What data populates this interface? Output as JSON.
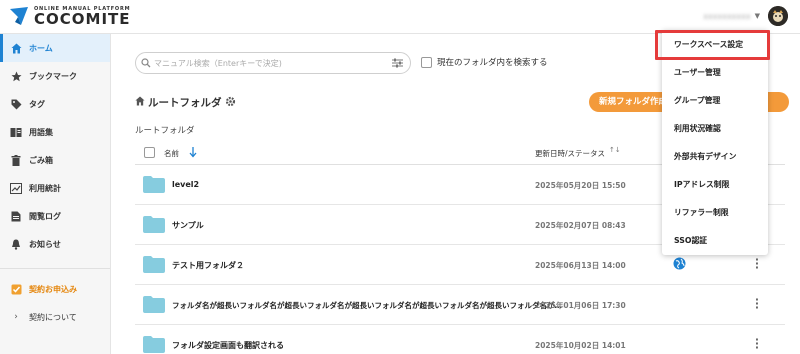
{
  "header": {
    "logo_sub": "ONLINE MANUAL PLATFORM",
    "logo_main": "COCOMITE",
    "user_name": "xxxxxxxxxx",
    "brand_color": "#1e82d2"
  },
  "sidebar": {
    "items": [
      {
        "label": "ホーム",
        "icon": "home-icon",
        "active": true
      },
      {
        "label": "ブックマーク",
        "icon": "star-icon"
      },
      {
        "label": "タグ",
        "icon": "tag-icon"
      },
      {
        "label": "用語集",
        "icon": "glossary-icon"
      },
      {
        "label": "ごみ箱",
        "icon": "trash-icon"
      },
      {
        "label": "利用統計",
        "icon": "chart-icon"
      },
      {
        "label": "閲覧ログ",
        "icon": "log-icon"
      },
      {
        "label": "お知らせ",
        "icon": "bell-icon"
      }
    ],
    "contract_apply": "契約お申込み",
    "contract_about": "契約について"
  },
  "search": {
    "placeholder": "マニュアル検索（Enterキーで決定)",
    "value": "",
    "current_folder_label": "現在のフォルダ内を検索する"
  },
  "main": {
    "folder_title": "ルートフォルダ",
    "new_folder_button": "新規フォルダ作成",
    "breadcrumb": "ルートフォルダ",
    "col_name": "名前",
    "col_date": "更新日時/ステータス",
    "rows": [
      {
        "name": "level2",
        "date": "2025年05月20日 15:50"
      },
      {
        "name": "サンプル",
        "date": "2025年02月07日 08:43"
      },
      {
        "name": "テスト用フォルダ２",
        "date": "2025年06月13日 14:00"
      },
      {
        "name": "フォルダ名が超長いフォルダ名が超長いフォルダ名が超長いフォルダ名が超長いフォルダ名が超長いフォルダ名が…",
        "date": "2025年01月06日 17:30"
      },
      {
        "name": "フォルダ設定画面も翻訳される",
        "date": "2025年10月02日 14:01"
      }
    ]
  },
  "dropdown": {
    "items": [
      "ワークスペース設定",
      "ユーザー管理",
      "グループ管理",
      "利用状況確認",
      "外部共有デザイン",
      "IPアドレス制限",
      "リファラー制限",
      "SSO認証"
    ],
    "highlight_color": "#e53b3b"
  }
}
